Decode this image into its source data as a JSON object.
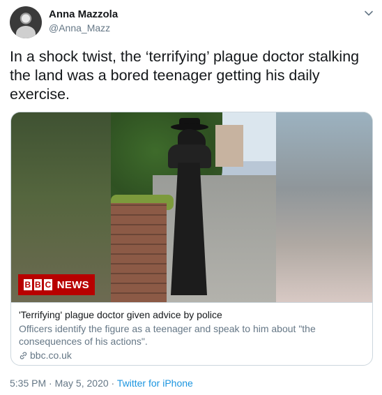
{
  "author": {
    "display_name": "Anna Mazzola",
    "handle": "@Anna_Mazz"
  },
  "tweet": {
    "text": "In a shock twist, the ‘terrifying’ plague doctor stalking the land was a bored teenager getting his daily exercise."
  },
  "card": {
    "badge_left": [
      "B",
      "B",
      "C"
    ],
    "badge_right": "NEWS",
    "title": "'Terrifying' plague doctor given advice by police",
    "description": "Officers identify the figure as a teenager and speak to him about \"the consequences of his actions\".",
    "domain": "bbc.co.uk"
  },
  "meta": {
    "time": "5:35 PM",
    "separator1": " · ",
    "date": "May 5, 2020",
    "separator2": " · ",
    "source": "Twitter for iPhone"
  },
  "icons": {
    "caret": "chevron-down-icon",
    "link": "link-icon"
  },
  "colors": {
    "link_blue": "#1b95e0",
    "muted": "#657786",
    "bbc_red": "#b80000"
  }
}
